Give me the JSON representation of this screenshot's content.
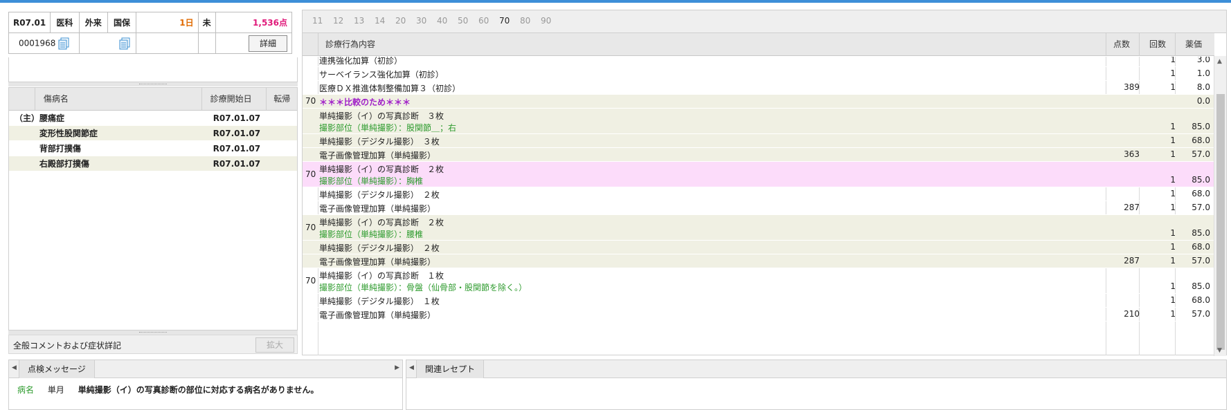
{
  "header": {
    "date": "R07.01",
    "dept": "医科",
    "visit": "外来",
    "insurance": "国保",
    "days": "1日",
    "status": "未",
    "points": "1,536点",
    "patient_id": "0001968",
    "detail_label": "詳細"
  },
  "diagnosis": {
    "columns": [
      "傷病名",
      "診療開始日",
      "転帰"
    ],
    "rows": [
      {
        "flag": "（主）",
        "name": "腰痛症",
        "date": "R07.01.07",
        "outcome": ""
      },
      {
        "flag": "",
        "name": "変形性股関節症",
        "date": "R07.01.07",
        "outcome": ""
      },
      {
        "flag": "",
        "name": "背部打撲傷",
        "date": "R07.01.07",
        "outcome": ""
      },
      {
        "flag": "",
        "name": "右殿部打撲傷",
        "date": "R07.01.07",
        "outcome": ""
      }
    ]
  },
  "comment": {
    "label": "全般コメントおよび症状詳記",
    "expand_label": "拡大"
  },
  "tabs": [
    "11",
    "12",
    "13",
    "14",
    "20",
    "30",
    "40",
    "50",
    "60",
    "70",
    "80",
    "90"
  ],
  "active_tab": "70",
  "grid": {
    "columns": {
      "name": "診療行為内容",
      "points": "点数",
      "count": "回数",
      "price": "薬価"
    },
    "rows": [
      {
        "code": "",
        "lines": [
          "連携強化加算（初診）"
        ],
        "sub": "",
        "points": "",
        "count": "1",
        "price": "3.0",
        "style": ""
      },
      {
        "code": "",
        "lines": [
          "サーベイランス強化加算（初診）"
        ],
        "sub": "",
        "points": "",
        "count": "1",
        "price": "1.0",
        "style": ""
      },
      {
        "code": "",
        "lines": [
          "医療ＤＸ推進体制整備加算３（初診）"
        ],
        "sub": "",
        "points": "389",
        "count": "1",
        "price": "8.0",
        "style": ""
      },
      {
        "code": "70",
        "lines": [
          "＊＊＊比較のため＊＊＊"
        ],
        "sub": "",
        "points": "",
        "count": "",
        "price": "0.0",
        "style": "alt purple"
      },
      {
        "code": "",
        "lines": [
          "単純撮影（イ）の写真診断　３枚"
        ],
        "sub": "撮影部位（単純撮影）：股関節＿；右",
        "points": "",
        "count": "1",
        "price": "85.0",
        "style": "alt"
      },
      {
        "code": "",
        "lines": [
          "単純撮影（デジタル撮影）　３枚"
        ],
        "sub": "",
        "points": "",
        "count": "1",
        "price": "68.0",
        "style": "alt"
      },
      {
        "code": "",
        "lines": [
          "電子画像管理加算（単純撮影）"
        ],
        "sub": "",
        "points": "363",
        "count": "1",
        "price": "57.0",
        "style": "alt"
      },
      {
        "code": "70",
        "lines": [
          "単純撮影（イ）の写真診断　２枚"
        ],
        "sub": "撮影部位（単純撮影）：胸椎",
        "points": "",
        "count": "1",
        "price": "85.0",
        "style": "pink"
      },
      {
        "code": "",
        "lines": [
          "単純撮影（デジタル撮影）　２枚"
        ],
        "sub": "",
        "points": "",
        "count": "1",
        "price": "68.0",
        "style": ""
      },
      {
        "code": "",
        "lines": [
          "電子画像管理加算（単純撮影）"
        ],
        "sub": "",
        "points": "287",
        "count": "1",
        "price": "57.0",
        "style": ""
      },
      {
        "code": "70",
        "lines": [
          "単純撮影（イ）の写真診断　２枚"
        ],
        "sub": "撮影部位（単純撮影）：腰椎",
        "points": "",
        "count": "1",
        "price": "85.0",
        "style": "alt"
      },
      {
        "code": "",
        "lines": [
          "単純撮影（デジタル撮影）　２枚"
        ],
        "sub": "",
        "points": "",
        "count": "1",
        "price": "68.0",
        "style": "alt"
      },
      {
        "code": "",
        "lines": [
          "電子画像管理加算（単純撮影）"
        ],
        "sub": "",
        "points": "287",
        "count": "1",
        "price": "57.0",
        "style": "alt"
      },
      {
        "code": "70",
        "lines": [
          "単純撮影（イ）の写真診断　１枚"
        ],
        "sub": "撮影部位（単純撮影）：骨盤（仙骨部・股関節を除く。）",
        "points": "",
        "count": "1",
        "price": "85.0",
        "style": ""
      },
      {
        "code": "",
        "lines": [
          "単純撮影（デジタル撮影）　１枚"
        ],
        "sub": "",
        "points": "",
        "count": "1",
        "price": "68.0",
        "style": ""
      },
      {
        "code": "",
        "lines": [
          "電子画像管理加算（単純撮影）"
        ],
        "sub": "",
        "points": "210",
        "count": "1",
        "price": "57.0",
        "style": ""
      }
    ]
  },
  "check_panel": {
    "tab_label": "点検メッセージ",
    "message": {
      "category": "病名",
      "period": "単月",
      "text": "単純撮影（イ）の写真診断の部位に対応する病名がありません。"
    }
  },
  "related_panel": {
    "tab_label": "関連レセプト"
  }
}
